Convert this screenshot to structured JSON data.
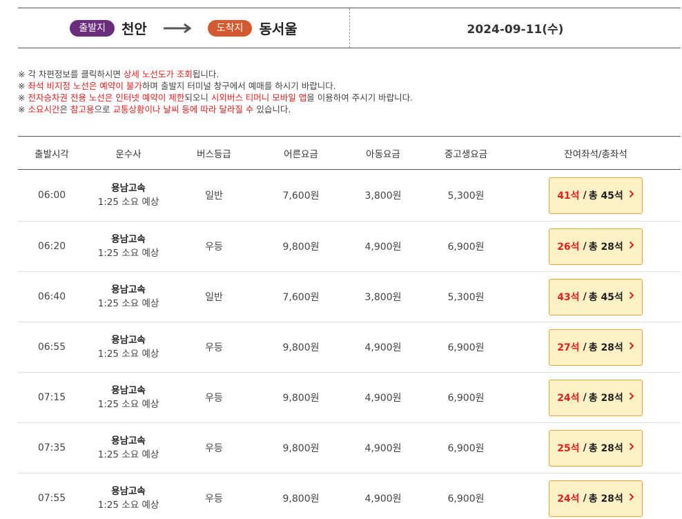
{
  "route": {
    "departure_label": "출발지",
    "departure_city": "천안",
    "arrival_label": "도착지",
    "arrival_city": "동서울",
    "date": "2024-09-11(수)",
    "colors": {
      "departure_pill": "#6b2c7e",
      "arrival_pill": "#d35a2e"
    }
  },
  "notices": [
    {
      "mark": "※",
      "parts": [
        {
          "text": " 각 차편정보를 클릭하시면 ",
          "red": false
        },
        {
          "text": "상세 노선도가 조회",
          "red": true
        },
        {
          "text": "됩니다.",
          "red": false
        }
      ]
    },
    {
      "mark": "※",
      "parts": [
        {
          "text": " ",
          "red": false
        },
        {
          "text": "좌석 비지정 노선은 예약이 불가",
          "red": true
        },
        {
          "text": "하며 출발지 터미널 창구에서 예매를 하시기 바랍니다.",
          "red": false
        }
      ]
    },
    {
      "mark": "※",
      "parts": [
        {
          "text": " ",
          "red": false
        },
        {
          "text": "전자승차권 전용 노선은 인터넷 예약이 제한",
          "red": true
        },
        {
          "text": "되오니 ",
          "red": false
        },
        {
          "text": "시외버스 티머니 모바일 앱",
          "red": true
        },
        {
          "text": "을 이용하여 주시기 바랍니다.",
          "red": false
        }
      ]
    },
    {
      "mark": "※",
      "parts": [
        {
          "text": " ",
          "red": false
        },
        {
          "text": "소요시간",
          "red": true
        },
        {
          "text": "은 ",
          "red": false
        },
        {
          "text": "참고용",
          "red": true
        },
        {
          "text": "으로 ",
          "red": false
        },
        {
          "text": "교통상황이나 날씨 등에 따라 달라질 수",
          "red": true
        },
        {
          "text": " 있습니다.",
          "red": false
        }
      ]
    }
  ],
  "table": {
    "headers": [
      "출발시각",
      "운수사",
      "버스등급",
      "어른요금",
      "아동요금",
      "중고생요금",
      "잔여좌석/총좌석"
    ],
    "rows": [
      {
        "time": "06:00",
        "operator": "용남고속",
        "duration": "1:25 소요 예상",
        "grade": "일반",
        "adult": "7,600원",
        "child": "3,800원",
        "student": "5,300원",
        "remaining": "41석",
        "total": "총 45석"
      },
      {
        "time": "06:20",
        "operator": "용남고속",
        "duration": "1:25 소요 예상",
        "grade": "우등",
        "adult": "9,800원",
        "child": "4,900원",
        "student": "6,900원",
        "remaining": "26석",
        "total": "총 28석"
      },
      {
        "time": "06:40",
        "operator": "용남고속",
        "duration": "1:25 소요 예상",
        "grade": "일반",
        "adult": "7,600원",
        "child": "3,800원",
        "student": "5,300원",
        "remaining": "43석",
        "total": "총 45석"
      },
      {
        "time": "06:55",
        "operator": "용남고속",
        "duration": "1:25 소요 예상",
        "grade": "우등",
        "adult": "9,800원",
        "child": "4,900원",
        "student": "6,900원",
        "remaining": "27석",
        "total": "총 28석"
      },
      {
        "time": "07:15",
        "operator": "용남고속",
        "duration": "1:25 소요 예상",
        "grade": "우등",
        "adult": "9,800원",
        "child": "4,900원",
        "student": "6,900원",
        "remaining": "24석",
        "total": "총 28석"
      },
      {
        "time": "07:35",
        "operator": "용남고속",
        "duration": "1:25 소요 예상",
        "grade": "우등",
        "adult": "9,800원",
        "child": "4,900원",
        "student": "6,900원",
        "remaining": "25석",
        "total": "총 28석"
      },
      {
        "time": "07:55",
        "operator": "용남고속",
        "duration": "1:25 소요 예상",
        "grade": "우등",
        "adult": "9,800원",
        "child": "4,900원",
        "student": "6,900원",
        "remaining": "24석",
        "total": "총 28석"
      }
    ],
    "seat_separator": "/",
    "icons": {
      "route_arrow": "right-arrow-icon",
      "seat_chevron": "chevron-right-icon"
    }
  }
}
